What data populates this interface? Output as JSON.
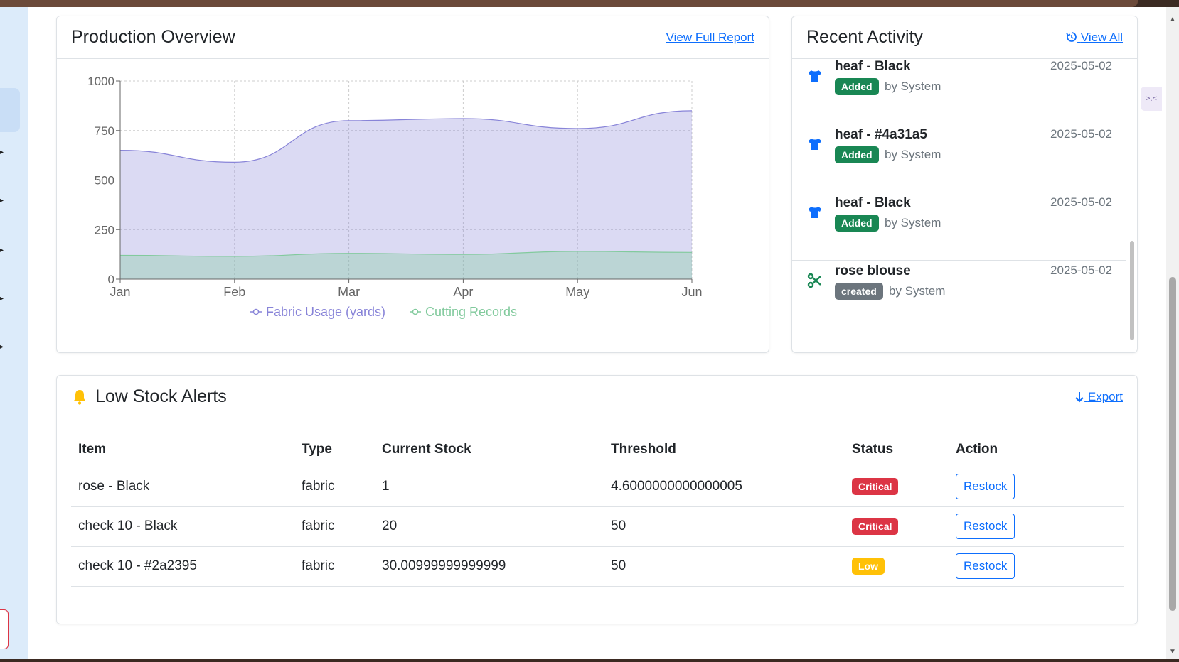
{
  "production": {
    "title": "Production Overview",
    "link": "View Full Report"
  },
  "chart_data": {
    "type": "area",
    "title": "",
    "xlabel": "",
    "ylabel": "",
    "categories": [
      "Jan",
      "Feb",
      "Mar",
      "Apr",
      "May",
      "Jun"
    ],
    "ylim": [
      0,
      1000
    ],
    "yticks": [
      "0",
      "250",
      "500",
      "750",
      "1000"
    ],
    "grid": true,
    "legend_position": "bottom",
    "series": [
      {
        "name": "Fabric Usage (yards)",
        "values": [
          650,
          590,
          800,
          810,
          760,
          850
        ],
        "color": "#8884d8"
      },
      {
        "name": "Cutting Records",
        "values": [
          120,
          115,
          130,
          125,
          140,
          135
        ],
        "color": "#82ca9d"
      }
    ]
  },
  "activity": {
    "title": "Recent Activity",
    "link": "View All",
    "items": [
      {
        "name": "heaf - Black",
        "date": "2025-05-02",
        "badge": "Added",
        "by": "by System",
        "icon": "tshirt-icon"
      },
      {
        "name": "heaf - #4a31a5",
        "date": "2025-05-02",
        "badge": "Added",
        "by": "by System",
        "icon": "tshirt-icon"
      },
      {
        "name": "heaf - Black",
        "date": "2025-05-02",
        "badge": "Added",
        "by": "by System",
        "icon": "tshirt-icon"
      },
      {
        "name": "rose blouse",
        "date": "2025-05-02",
        "badge": "created",
        "by": "by System",
        "icon": "scissors-icon"
      }
    ]
  },
  "stock": {
    "title": "Low Stock Alerts",
    "export": "Export",
    "columns": [
      "Item",
      "Type",
      "Current Stock",
      "Threshold",
      "Status",
      "Action"
    ],
    "rows": [
      {
        "item": "rose - Black",
        "type": "fabric",
        "current": "1",
        "threshold": "4.6000000000000005",
        "status": "Critical",
        "action": "Restock"
      },
      {
        "item": "check 10 - Black",
        "type": "fabric",
        "current": "20",
        "threshold": "50",
        "status": "Critical",
        "action": "Restock"
      },
      {
        "item": "check 10 - #2a2395",
        "type": "fabric",
        "current": "30.00999999999999",
        "threshold": "50",
        "status": "Low",
        "action": "Restock"
      }
    ]
  },
  "colors": {
    "primary": "#0d6efd",
    "success": "#198754",
    "danger": "#dc3545",
    "warning": "#ffc107",
    "secondary": "#6c757d"
  }
}
